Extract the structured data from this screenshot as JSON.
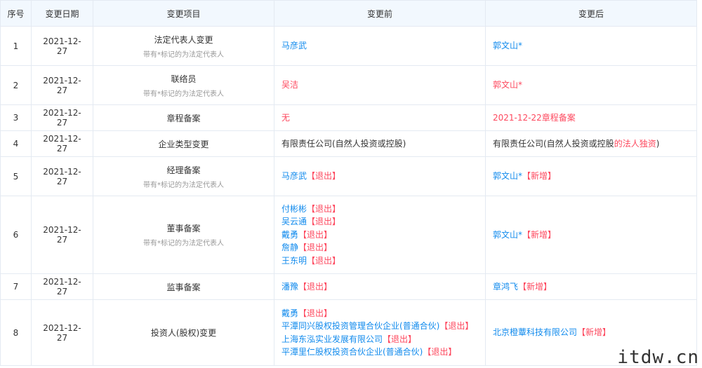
{
  "headers": {
    "index": "序号",
    "date": "变更日期",
    "item": "变更项目",
    "before": "变更前",
    "after": "变更后"
  },
  "note": "带有*标记的为法定代表人",
  "rows": [
    {
      "index": "1",
      "date": "2021-12-27",
      "item": "法定代表人变更",
      "show_note": true,
      "height": 56,
      "before": [
        [
          {
            "t": "马彦武",
            "c": "blue"
          }
        ]
      ],
      "after": [
        [
          {
            "t": "郭文山*",
            "c": "blue"
          }
        ]
      ]
    },
    {
      "index": "2",
      "date": "2021-12-27",
      "item": "联络员",
      "show_note": true,
      "height": 56,
      "before": [
        [
          {
            "t": "吴洁",
            "c": "red"
          }
        ]
      ],
      "after": [
        [
          {
            "t": "郭文山*",
            "c": "red"
          }
        ]
      ]
    },
    {
      "index": "3",
      "date": "2021-12-27",
      "item": "章程备案",
      "show_note": false,
      "height": 37,
      "before": [
        [
          {
            "t": "无",
            "c": "red"
          }
        ]
      ],
      "after": [
        [
          {
            "t": "2021-12-22章程备案",
            "c": "red"
          }
        ]
      ]
    },
    {
      "index": "4",
      "date": "2021-12-27",
      "item": "企业类型变更",
      "show_note": false,
      "height": 37,
      "before": [
        [
          {
            "t": "有限责任公司(自然人投资或控股)",
            "c": "dark"
          }
        ]
      ],
      "after": [
        [
          {
            "t": "有限责任公司(自然人投资或控股",
            "c": "dark"
          },
          {
            "t": "的法人独资",
            "c": "red"
          },
          {
            "t": ")",
            "c": "dark"
          }
        ]
      ]
    },
    {
      "index": "5",
      "date": "2021-12-27",
      "item": "经理备案",
      "show_note": true,
      "height": 56,
      "before": [
        [
          {
            "t": "马彦武",
            "c": "blue"
          },
          {
            "t": "【退出】",
            "c": "red"
          }
        ]
      ],
      "after": [
        [
          {
            "t": "郭文山*",
            "c": "blue"
          },
          {
            "t": "【新增】",
            "c": "red"
          }
        ]
      ]
    },
    {
      "index": "6",
      "date": "2021-12-27",
      "item": "董事备案",
      "show_note": true,
      "height": 111,
      "before": [
        [
          {
            "t": "付彬彬",
            "c": "blue"
          },
          {
            "t": "【退出】",
            "c": "red"
          }
        ],
        [
          {
            "t": "吴云通",
            "c": "blue"
          },
          {
            "t": "【退出】",
            "c": "red"
          }
        ],
        [
          {
            "t": "戴勇",
            "c": "blue"
          },
          {
            "t": "【退出】",
            "c": "red"
          }
        ],
        [
          {
            "t": "詹静",
            "c": "blue"
          },
          {
            "t": "【退出】",
            "c": "red"
          }
        ],
        [
          {
            "t": "王东明",
            "c": "blue"
          },
          {
            "t": "【退出】",
            "c": "red"
          }
        ]
      ],
      "after": [
        [
          {
            "t": "郭文山*",
            "c": "blue"
          },
          {
            "t": "【新增】",
            "c": "red"
          }
        ]
      ]
    },
    {
      "index": "7",
      "date": "2021-12-27",
      "item": "监事备案",
      "show_note": false,
      "height": 37,
      "before": [
        [
          {
            "t": "潘豫",
            "c": "blue"
          },
          {
            "t": "【退出】",
            "c": "red"
          }
        ]
      ],
      "after": [
        [
          {
            "t": "章鸿飞",
            "c": "blue"
          },
          {
            "t": "【新增】",
            "c": "red"
          }
        ]
      ]
    },
    {
      "index": "8",
      "date": "2021-12-27",
      "item": "投资人(股权)变更",
      "show_note": false,
      "height": 94,
      "before": [
        [
          {
            "t": "戴勇",
            "c": "blue"
          },
          {
            "t": "【退出】",
            "c": "red"
          }
        ],
        [
          {
            "t": "平潭同兴股权投资管理合伙企业(普通合伙)",
            "c": "blue"
          },
          {
            "t": "【退出】",
            "c": "red"
          }
        ],
        [
          {
            "t": "上海东泓实业发展有限公司",
            "c": "blue"
          },
          {
            "t": "【退出】",
            "c": "red"
          }
        ],
        [
          {
            "t": "平潭里仁股权投资合伙企业(普通合伙)",
            "c": "blue"
          },
          {
            "t": "【退出】",
            "c": "red"
          }
        ]
      ],
      "after": [
        [
          {
            "t": "北京橙蕈科技有限公司",
            "c": "blue"
          },
          {
            "t": "【新增】",
            "c": "red"
          }
        ]
      ]
    }
  ],
  "watermark": "itdw.cn"
}
